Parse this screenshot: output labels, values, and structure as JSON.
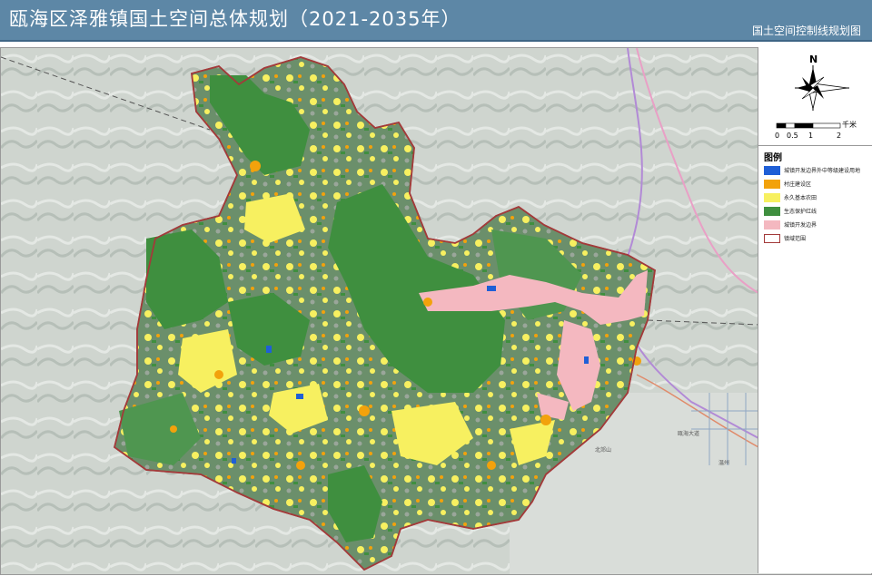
{
  "header": {
    "title": "瓯海区泽雅镇国土空间总体规划（2021-2035年）",
    "subtitle": "国土空间控制线规划图"
  },
  "compass": {
    "north_label": "N"
  },
  "scale_bar": {
    "unit": "千米",
    "ticks": [
      "0",
      "0.5",
      "1",
      "2"
    ]
  },
  "legend": {
    "title": "图例",
    "items": [
      {
        "label": "城镇开发边界外中等级建设用地",
        "color": "#1f5fd6",
        "kind": "fill"
      },
      {
        "label": "村庄建设区",
        "color": "#f2a20c",
        "kind": "fill"
      },
      {
        "label": "永久基本农田",
        "color": "#f7f060",
        "kind": "fill"
      },
      {
        "label": "生态保护红线",
        "color": "#3f8f3f",
        "kind": "fill"
      },
      {
        "label": "城镇开发边界",
        "color": "#f4b8c0",
        "kind": "fill"
      },
      {
        "label": "镇域范围",
        "color": "#a33a3a",
        "kind": "outline"
      }
    ]
  },
  "map": {
    "place_labels": {
      "north_town": "北郊山",
      "east_town_1": "瓯海大道",
      "east_town_2": "温州"
    },
    "colors": {
      "terrain": "#cdd3cd",
      "terrain_dark": "#a9b2ab",
      "boundary": "#a33a3a",
      "ecology": "#3f8f3f",
      "farmland": "#f7f060",
      "village": "#f2a20c",
      "urban": "#f4b8c0",
      "special": "#1f5fd6",
      "road_purple": "#b28ad6",
      "road_pink": "#e9a0c6"
    }
  }
}
